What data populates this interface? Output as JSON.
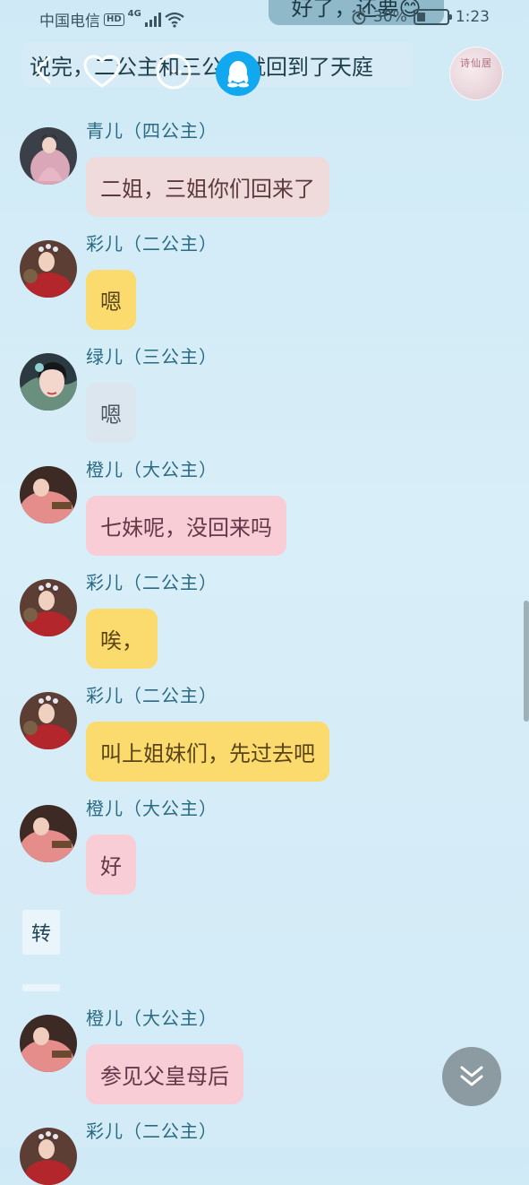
{
  "status_bar": {
    "carrier": "中国电信",
    "hd_badge": "HD",
    "network_type": "4G",
    "battery": "30%",
    "battery_level": 0.3,
    "time": "1:23"
  },
  "top_bubble_text": "好了，还要😊",
  "narration": "说完，二公主和三公主就回到了天庭",
  "cover_thumb_text": "诗仙居",
  "messages": [
    {
      "sender": "青儿（四公主）",
      "text": "二姐，三姐你们回来了",
      "bubble_color": "#f0dbdc",
      "avatar": "qing"
    },
    {
      "sender": "彩儿（二公主）",
      "text": "嗯",
      "bubble_color": "#fbdb6d",
      "avatar": "cai"
    },
    {
      "sender": "绿儿（三公主）",
      "text": "嗯",
      "bubble_color": "#dce6ee",
      "avatar": "lv"
    },
    {
      "sender": "橙儿（大公主）",
      "text": "七妹呢，没回来吗",
      "bubble_color": "#f8cdd6",
      "avatar": "cheng"
    },
    {
      "sender": "彩儿（二公主）",
      "text": "唉，",
      "bubble_color": "#fbdb6d",
      "avatar": "cai"
    },
    {
      "sender": "彩儿（二公主）",
      "text": "叫上姐妹们，先过去吧",
      "bubble_color": "#fbdb6d",
      "avatar": "cai"
    },
    {
      "sender": "橙儿（大公主）",
      "text": "好",
      "bubble_color": "#f8cdd6",
      "avatar": "cheng"
    },
    {
      "sender": "橙儿（大公主）",
      "text": "参见父皇母后",
      "bubble_color": "#f8cdd6",
      "avatar": "cheng"
    },
    {
      "sender": "彩儿（二公主）",
      "text": "",
      "bubble_color": "#fbdb6d",
      "avatar": "cai"
    }
  ],
  "transition_note": "转",
  "icons": {
    "back": "back-icon",
    "favorite": "heart-icon",
    "comment": "comment-icon",
    "qq": "qq-penguin-icon",
    "jump_to_latest": "double-chevron-down-icon"
  }
}
